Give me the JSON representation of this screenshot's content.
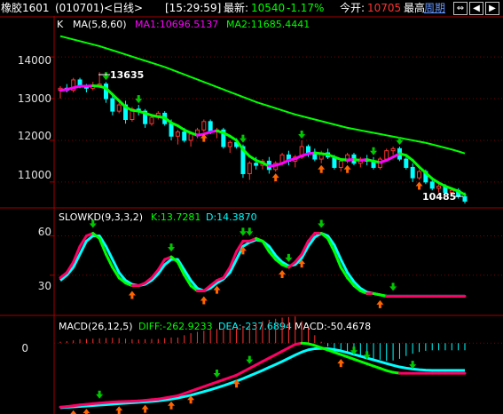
{
  "title_bar": {
    "instrument": "橡胶1601",
    "code": "(010701)",
    "period": "<日线>",
    "time": "[15:29:59]",
    "latest_label": "最新:",
    "latest_value": "10540",
    "change_pct": "-1.17%",
    "open_label": "今开:",
    "open_value": "10705",
    "high_label": "最高",
    "weekly_link": "周期"
  },
  "colors": {
    "up": "#ff3232",
    "down": "#00ffff",
    "ma1": "#ff00ff",
    "ma2": "#00ff00",
    "grid": "#7a0000",
    "panel_border": "#a00000",
    "text_white": "#ffffff",
    "arrow_up": "#ff6400",
    "arrow_down": "#00c800"
  },
  "price_panel": {
    "header_k": "K",
    "header_ma": "MA(5,8,60)",
    "ma1_text": "MA1:10696.5137",
    "ma2_text": "MA2:11685.4441",
    "y_ticks": [
      "14000",
      "13000",
      "12000",
      "11000"
    ],
    "high_annotation": "13635",
    "low_annotation": "10485"
  },
  "kd_panel": {
    "header": "SLOWKD(9,3,3,2)",
    "k_text": "K:13.7281",
    "d_text": "D:14.3870",
    "y_ticks": [
      "60",
      "30"
    ]
  },
  "macd_panel": {
    "header": "MACD(26,12,5)",
    "diff_text": "DIFF:-262.9233",
    "dea_text": "DEA:-237.6894",
    "macd_text": "MACD:-50.4678",
    "y_ticks": [
      "0"
    ]
  },
  "chart_data": {
    "type": "candlestick",
    "price": {
      "ylim": [
        10400,
        14600
      ],
      "candles": [
        [
          13200,
          13300,
          13000,
          13250
        ],
        [
          13250,
          13350,
          13150,
          13200
        ],
        [
          13200,
          13500,
          13150,
          13450
        ],
        [
          13450,
          13500,
          13250,
          13300
        ],
        [
          13300,
          13350,
          13150,
          13250
        ],
        [
          13250,
          13400,
          13200,
          13300
        ],
        [
          13300,
          13635,
          13250,
          13350
        ],
        [
          13350,
          13400,
          12900,
          13000
        ],
        [
          13000,
          13100,
          12600,
          12700
        ],
        [
          12700,
          12900,
          12650,
          12850
        ],
        [
          12850,
          12950,
          12400,
          12500
        ],
        [
          12500,
          12800,
          12450,
          12750
        ],
        [
          12750,
          12850,
          12600,
          12700
        ],
        [
          12700,
          12750,
          12300,
          12400
        ],
        [
          12400,
          12600,
          12350,
          12550
        ],
        [
          12550,
          12700,
          12500,
          12650
        ],
        [
          12650,
          12700,
          12350,
          12400
        ],
        [
          12400,
          12500,
          12000,
          12100
        ],
        [
          12100,
          12250,
          11900,
          12200
        ],
        [
          12200,
          12300,
          11950,
          12000
        ],
        [
          12000,
          12200,
          11850,
          12150
        ],
        [
          12150,
          12300,
          12050,
          12250
        ],
        [
          12250,
          12500,
          12200,
          12450
        ],
        [
          12450,
          12500,
          12150,
          12200
        ],
        [
          12200,
          12300,
          12050,
          12250
        ],
        [
          12250,
          12300,
          11800,
          11850
        ],
        [
          11850,
          12000,
          11700,
          11950
        ],
        [
          11950,
          12050,
          11800,
          11850
        ],
        [
          11850,
          11900,
          11100,
          11200
        ],
        [
          11200,
          11500,
          11050,
          11450
        ],
        [
          11450,
          11600,
          11300,
          11400
        ],
        [
          11400,
          11550,
          11300,
          11500
        ],
        [
          11500,
          11600,
          11200,
          11300
        ],
        [
          11300,
          11500,
          11250,
          11450
        ],
        [
          11450,
          11700,
          11400,
          11650
        ],
        [
          11650,
          11750,
          11400,
          11500
        ],
        [
          11500,
          11650,
          11350,
          11600
        ],
        [
          11600,
          12000,
          11550,
          11850
        ],
        [
          11850,
          11900,
          11600,
          11700
        ],
        [
          11700,
          11800,
          11500,
          11550
        ],
        [
          11550,
          11750,
          11450,
          11700
        ],
        [
          11700,
          11800,
          11550,
          11600
        ],
        [
          11600,
          11650,
          11300,
          11350
        ],
        [
          11350,
          11550,
          11250,
          11500
        ],
        [
          11500,
          11700,
          11450,
          11650
        ],
        [
          11650,
          11700,
          11400,
          11450
        ],
        [
          11450,
          11600,
          11350,
          11550
        ],
        [
          11550,
          11650,
          11400,
          11500
        ],
        [
          11500,
          11600,
          11300,
          11350
        ],
        [
          11350,
          11600,
          11300,
          11550
        ],
        [
          11550,
          11800,
          11500,
          11750
        ],
        [
          11750,
          11850,
          11650,
          11800
        ],
        [
          11800,
          11850,
          11500,
          11550
        ],
        [
          11550,
          11650,
          11300,
          11350
        ],
        [
          11350,
          11450,
          11000,
          11100
        ],
        [
          11100,
          11300,
          11050,
          11250
        ],
        [
          11250,
          11300,
          10950,
          11000
        ],
        [
          11000,
          11100,
          10800,
          10850
        ],
        [
          10850,
          10950,
          10750,
          10900
        ],
        [
          10900,
          10950,
          10700,
          10750
        ],
        [
          10750,
          10850,
          10650,
          10800
        ],
        [
          10800,
          10850,
          10600,
          10650
        ],
        [
          10650,
          10750,
          10485,
          10540
        ]
      ],
      "ma1": [
        13200,
        13220,
        13260,
        13300,
        13300,
        13310,
        13300,
        13250,
        13100,
        12950,
        12800,
        12720,
        12700,
        12650,
        12600,
        12570,
        12540,
        12420,
        12350,
        12250,
        12180,
        12120,
        12150,
        12200,
        12230,
        12180,
        12100,
        12000,
        11780,
        11620,
        11520,
        11460,
        11380,
        11400,
        11450,
        11520,
        11560,
        11630,
        11680,
        11700,
        11680,
        11660,
        11600,
        11540,
        11530,
        11540,
        11520,
        11540,
        11500,
        11470,
        11520,
        11600,
        11680,
        11640,
        11520,
        11360,
        11220,
        11080,
        10980,
        10900,
        10840,
        10780,
        10697
      ],
      "ma2": [
        14500,
        14460,
        14420,
        14380,
        14340,
        14300,
        14260,
        14210,
        14160,
        14110,
        14060,
        14010,
        13960,
        13910,
        13860,
        13810,
        13760,
        13700,
        13640,
        13580,
        13520,
        13460,
        13400,
        13340,
        13280,
        13220,
        13160,
        13100,
        13040,
        12980,
        12920,
        12870,
        12820,
        12770,
        12720,
        12670,
        12620,
        12580,
        12540,
        12500,
        12460,
        12420,
        12380,
        12340,
        12300,
        12270,
        12240,
        12210,
        12180,
        12150,
        12120,
        12090,
        12060,
        12030,
        12000,
        11970,
        11940,
        11900,
        11860,
        11820,
        11780,
        11735,
        11685
      ]
    },
    "kd": {
      "ylim": [
        0,
        80
      ],
      "k": [
        28,
        32,
        40,
        52,
        60,
        62,
        58,
        46,
        36,
        28,
        24,
        22,
        22,
        24,
        28,
        34,
        42,
        44,
        40,
        30,
        22,
        18,
        18,
        22,
        26,
        28,
        36,
        48,
        56,
        56,
        58,
        56,
        48,
        42,
        38,
        36,
        40,
        46,
        56,
        62,
        62,
        58,
        48,
        36,
        28,
        22,
        18,
        16,
        16,
        15,
        14,
        14,
        14,
        14,
        14,
        14,
        14,
        14,
        14,
        14,
        14,
        14,
        14
      ],
      "d": [
        26,
        30,
        36,
        46,
        56,
        60,
        60,
        52,
        42,
        32,
        26,
        23,
        22,
        23,
        26,
        31,
        38,
        42,
        42,
        34,
        26,
        20,
        18,
        20,
        24,
        27,
        32,
        42,
        52,
        55,
        57,
        56,
        52,
        45,
        40,
        37,
        38,
        43,
        52,
        59,
        62,
        60,
        53,
        42,
        32,
        25,
        20,
        17,
        16,
        15,
        14,
        14,
        14,
        14,
        14,
        14,
        14,
        14,
        14,
        14,
        14,
        14,
        14
      ]
    },
    "macd": {
      "ylim": [
        -620,
        80
      ],
      "diff": [
        -560,
        -555,
        -548,
        -540,
        -535,
        -530,
        -525,
        -520,
        -515,
        -512,
        -510,
        -508,
        -505,
        -500,
        -495,
        -490,
        -480,
        -470,
        -460,
        -440,
        -420,
        -400,
        -380,
        -360,
        -340,
        -320,
        -300,
        -280,
        -250,
        -220,
        -190,
        -160,
        -130,
        -100,
        -70,
        -40,
        -10,
        0,
        -5,
        -20,
        -40,
        -60,
        -80,
        -100,
        -120,
        -140,
        -160,
        -180,
        -200,
        -220,
        -240,
        -255,
        -263,
        -263,
        -263,
        -263,
        -263,
        -263,
        -263,
        -263,
        -263,
        -263,
        -263
      ],
      "dea": [
        -565,
        -562,
        -558,
        -554,
        -550,
        -546,
        -542,
        -538,
        -534,
        -530,
        -526,
        -522,
        -518,
        -514,
        -510,
        -505,
        -498,
        -490,
        -480,
        -468,
        -455,
        -440,
        -424,
        -408,
        -390,
        -372,
        -352,
        -332,
        -310,
        -286,
        -262,
        -238,
        -212,
        -186,
        -160,
        -132,
        -104,
        -78,
        -58,
        -48,
        -45,
        -48,
        -56,
        -68,
        -82,
        -98,
        -114,
        -130,
        -146,
        -162,
        -178,
        -194,
        -208,
        -218,
        -226,
        -232,
        -236,
        -238,
        -238,
        -238,
        -238,
        -238,
        -238
      ],
      "hist": [
        10,
        14,
        20,
        28,
        30,
        32,
        34,
        36,
        38,
        36,
        32,
        28,
        26,
        28,
        30,
        30,
        36,
        40,
        40,
        56,
        70,
        80,
        88,
        96,
        100,
        104,
        104,
        104,
        120,
        132,
        144,
        156,
        164,
        172,
        180,
        184,
        188,
        156,
        106,
        56,
        10,
        -24,
        -48,
        -64,
        -76,
        -84,
        -92,
        -100,
        -108,
        -116,
        -124,
        -122,
        -110,
        -90,
        -74,
        -62,
        -54,
        -50,
        -50,
        -50,
        -50,
        -50,
        -50
      ]
    }
  }
}
